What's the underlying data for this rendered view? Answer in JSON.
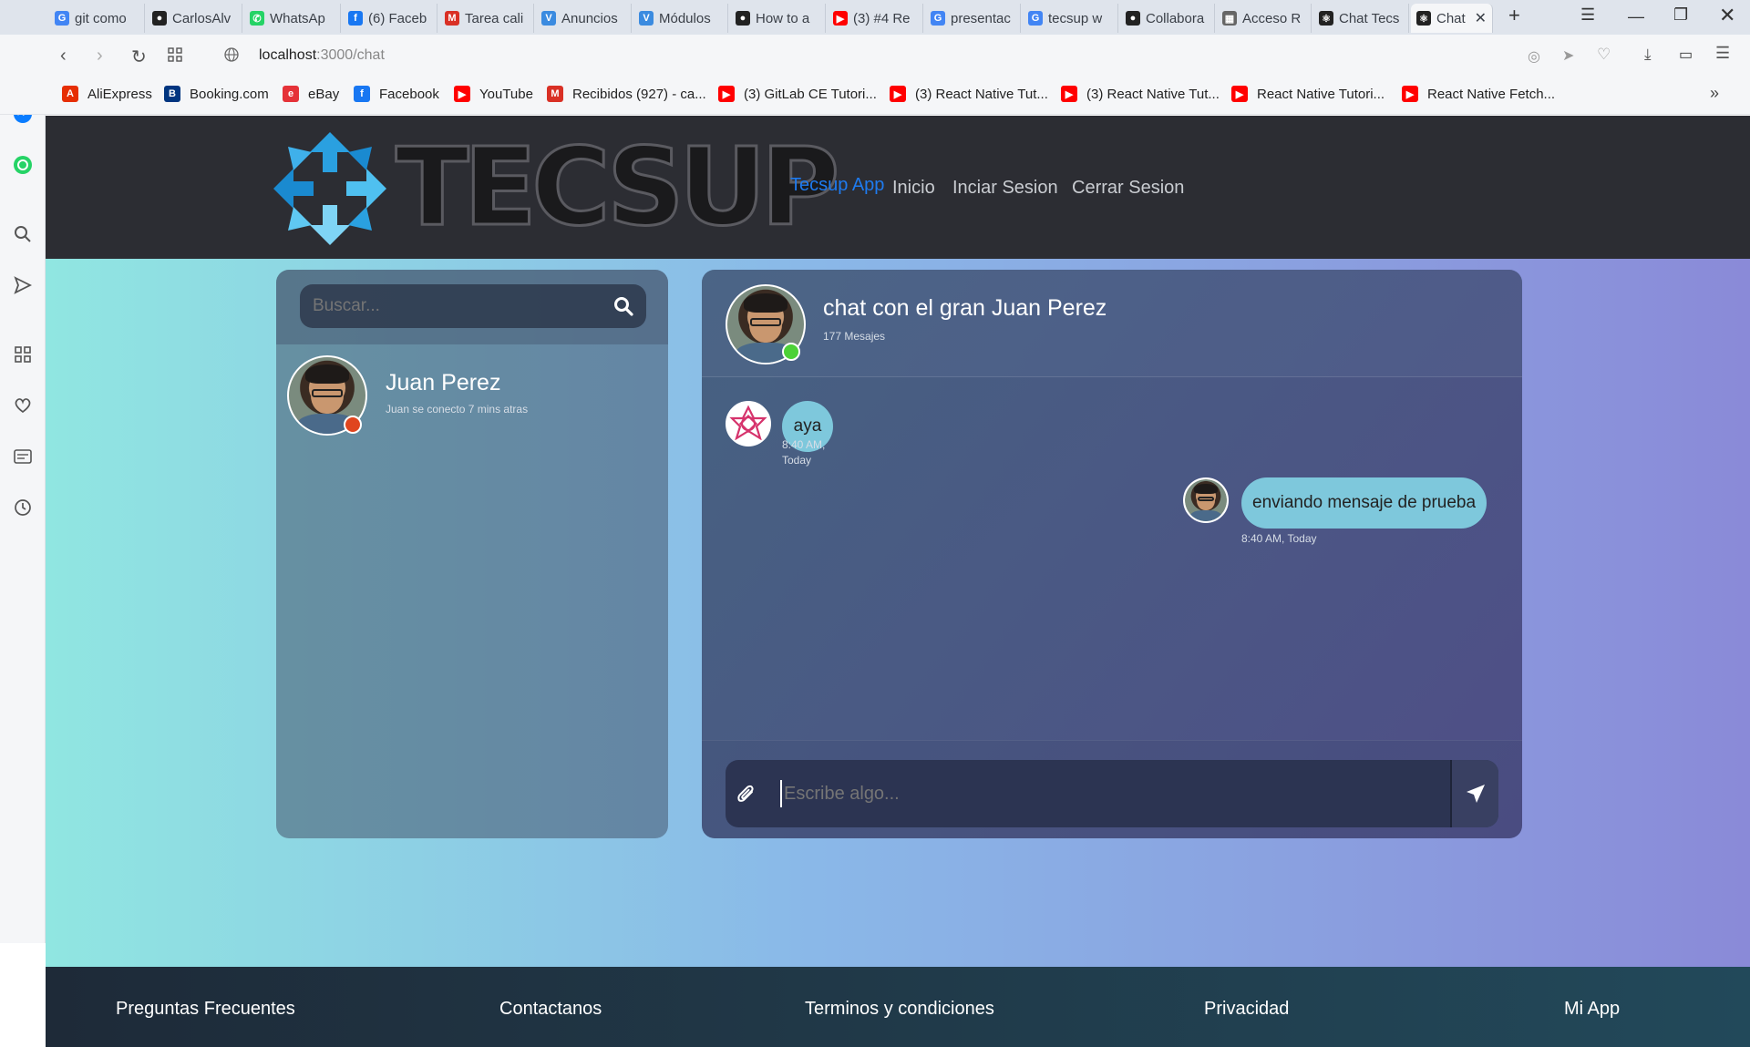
{
  "browser": {
    "tabs": [
      {
        "label": "git como",
        "icon": "google-icon",
        "color": "#4285f4"
      },
      {
        "label": "CarlosAlv",
        "icon": "github-icon",
        "color": "#222222"
      },
      {
        "label": "WhatsAp",
        "icon": "whatsapp-icon",
        "color": "#25d366"
      },
      {
        "label": "(6) Faceb",
        "icon": "facebook-icon",
        "color": "#1877f2"
      },
      {
        "label": "Tarea cali",
        "icon": "gmail-icon",
        "color": "#d93025"
      },
      {
        "label": "Anuncios",
        "icon": "v-icon",
        "color": "#3b8be0"
      },
      {
        "label": "Módulos",
        "icon": "v-icon",
        "color": "#3b8be0"
      },
      {
        "label": "How to a",
        "icon": "github-icon",
        "color": "#222222"
      },
      {
        "label": "(3) #4 Re",
        "icon": "youtube-icon",
        "color": "#ff0000"
      },
      {
        "label": "presentac",
        "icon": "google-icon",
        "color": "#4285f4"
      },
      {
        "label": "tecsup w",
        "icon": "google-icon",
        "color": "#4285f4"
      },
      {
        "label": "Collabora",
        "icon": "github-icon",
        "color": "#222222"
      },
      {
        "label": "Acceso R",
        "icon": "grid-icon",
        "color": "#666666"
      },
      {
        "label": "Chat Tecs",
        "icon": "react-icon",
        "color": "#222222"
      },
      {
        "label": "Chat",
        "icon": "react-icon",
        "color": "#222222"
      }
    ],
    "url_host": "localhost",
    "url_path": ":3000/chat",
    "bookmarks": [
      {
        "label": "AliExpress",
        "icon": "aliexpress-icon",
        "color": "#e62e04"
      },
      {
        "label": "Booking.com",
        "icon": "booking-icon",
        "color": "#003580"
      },
      {
        "label": "eBay",
        "icon": "ebay-icon",
        "color": "#e53238"
      },
      {
        "label": "Facebook",
        "icon": "facebook-icon",
        "color": "#1877f2"
      },
      {
        "label": "YouTube",
        "icon": "youtube-icon",
        "color": "#ff0000"
      },
      {
        "label": "Recibidos (927) - ca...",
        "icon": "gmail-icon",
        "color": "#d93025"
      },
      {
        "label": "(3) GitLab CE Tutori...",
        "icon": "youtube-icon",
        "color": "#ff0000"
      },
      {
        "label": "(3) React Native Tut...",
        "icon": "youtube-icon",
        "color": "#ff0000"
      },
      {
        "label": "(3) React Native Tut...",
        "icon": "youtube-icon",
        "color": "#ff0000"
      },
      {
        "label": "React Native Tutori...",
        "icon": "youtube-icon",
        "color": "#ff0000"
      },
      {
        "label": "React Native Fetch...",
        "icon": "youtube-icon",
        "color": "#ff0000"
      }
    ]
  },
  "nav": {
    "logo_text": "TECSUP",
    "brand": "Tecsup App",
    "links": [
      "Inicio",
      "Inciar Sesion",
      "Cerrar Sesion"
    ]
  },
  "contacts": {
    "search_placeholder": "Buscar...",
    "items": [
      {
        "name": "Juan Perez",
        "status": "Juan se conecto 7 mins atras",
        "online": false
      }
    ]
  },
  "chat": {
    "title": "chat con el gran Juan Perez",
    "count": "177 Mesajes",
    "messages": [
      {
        "text": "aya",
        "time": "8:40 AM, Today",
        "side": "received"
      },
      {
        "text": "enviando mensaje de prueba",
        "time": "8:40 AM, Today",
        "side": "sent"
      }
    ],
    "input_placeholder": "Escribe algo..."
  },
  "footer": {
    "links": [
      "Preguntas Frecuentes",
      "Contactanos",
      "Terminos y condiciones",
      "Privacidad",
      "Mi App"
    ]
  },
  "colors": {
    "navbar": "#2c2d33",
    "brand": "#1e7bf0",
    "offline_dot": "#e0451e",
    "online_dot": "#4cd137",
    "bubble": "#7ec8dc"
  }
}
